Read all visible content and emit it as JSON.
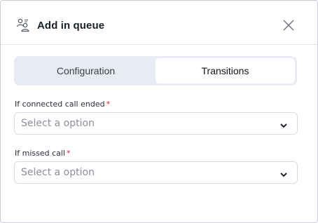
{
  "dialog": {
    "title": "Add in queue",
    "header_icon": "queue-people-icon",
    "close_icon": "close-icon"
  },
  "tabs": [
    {
      "label": "Configuration",
      "active": false
    },
    {
      "label": "Transitions",
      "active": true
    }
  ],
  "fields": [
    {
      "label": "If connected call ended",
      "required_mark": "*",
      "placeholder": "Select a option"
    },
    {
      "label": "If missed call",
      "required_mark": "*",
      "placeholder": "Select a option"
    }
  ],
  "colors": {
    "required": "#d0273b",
    "tab_track": "#e8ebf3",
    "placeholder": "#8a8f9c"
  }
}
